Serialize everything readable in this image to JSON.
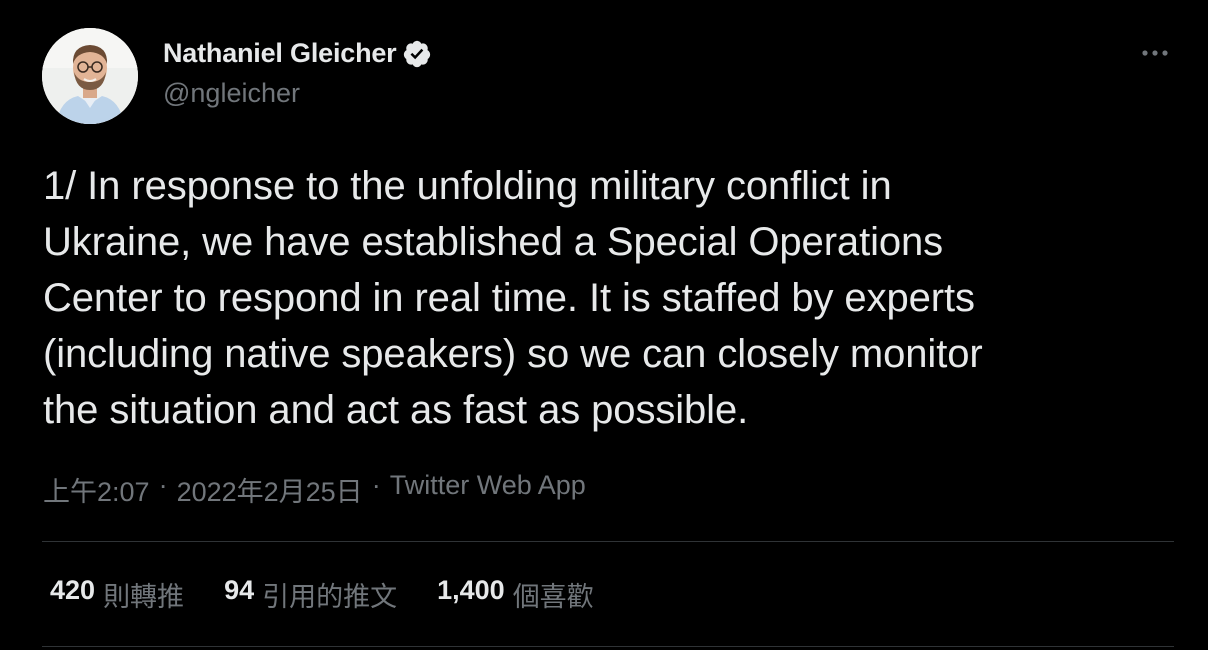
{
  "author": {
    "display_name": "Nathaniel Gleicher",
    "handle": "@ngleicher",
    "verified": true,
    "avatar_icon": "profile-photo"
  },
  "tweet": {
    "text": "1/ In response to the unfolding military conflict in\nUkraine, we have established a Special Operations\nCenter to respond in real time. It is staffed by experts\n(including native speakers) so we can closely monitor\nthe situation and act as fast as possible.",
    "time": "上午2:07",
    "separator": "·",
    "date": "2022年2月25日",
    "source": "Twitter Web App"
  },
  "stats": [
    {
      "count": "420",
      "label": "則轉推"
    },
    {
      "count": "94",
      "label": "引用的推文"
    },
    {
      "count": "1,400",
      "label": "個喜歡"
    }
  ],
  "colors": {
    "background": "#000000",
    "text_primary": "#e7e9ea",
    "text_secondary": "#71767b",
    "divider": "#2f3336",
    "verified_badge": "#e7e9ea"
  },
  "icons": {
    "more": "more-horizontal-icon",
    "verified": "verified-badge-icon"
  }
}
